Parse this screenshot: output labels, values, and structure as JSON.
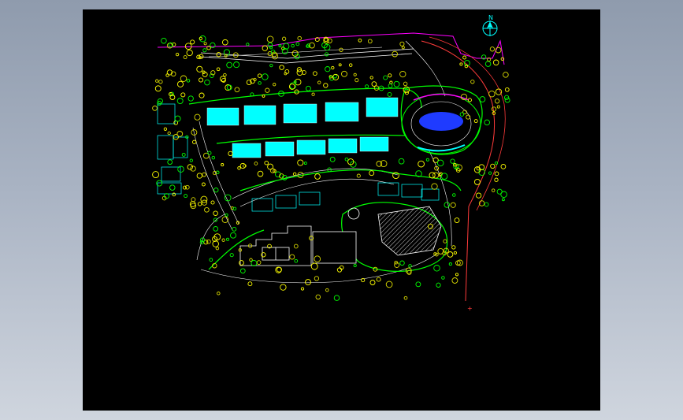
{
  "viewport": {
    "background": "#000000",
    "surround_gradient": [
      "#8f9bad",
      "#cfd5de"
    ]
  },
  "north_arrow": {
    "label": "N"
  },
  "legend_text": {
    "upper_right": "",
    "bottom_center": ""
  },
  "layer_colors": {
    "vegetation": "#ffff00",
    "vegetation_alt": "#d8d800",
    "buildings": "#00ffff",
    "hardscape": "#00ff00",
    "roads": "#ff3b3b",
    "boundary": "#ff00ff",
    "walls": "#ffffff",
    "water": "#1f3bff",
    "notes": "#00ffff"
  }
}
